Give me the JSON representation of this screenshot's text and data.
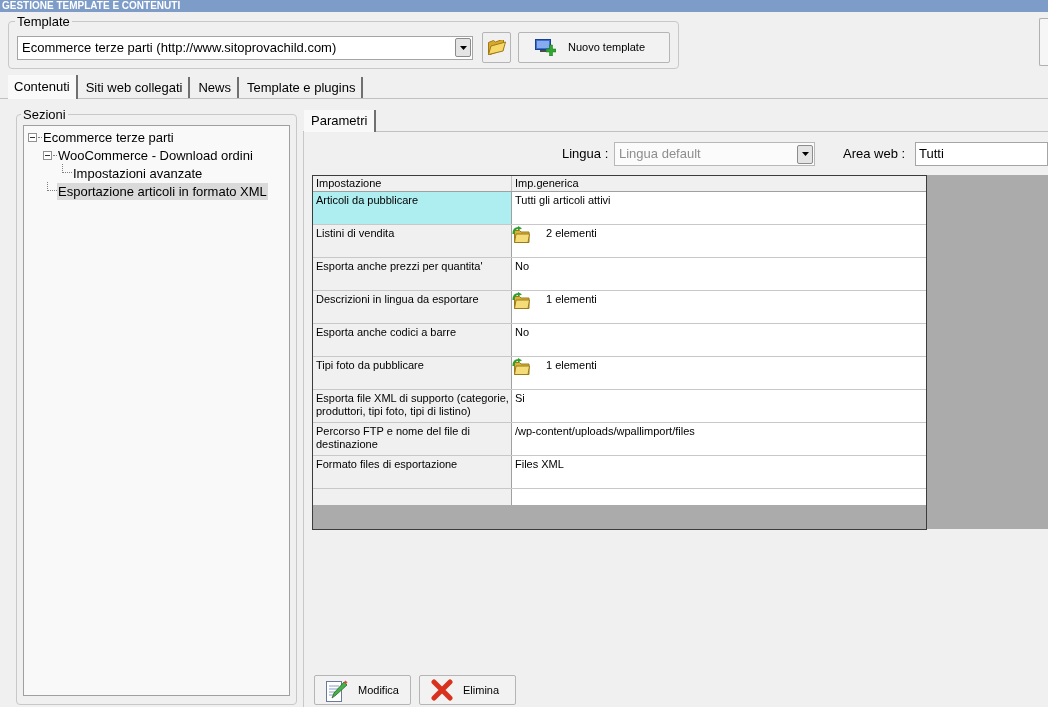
{
  "window": {
    "title": "GESTIONE TEMPLATE E CONTENUTI"
  },
  "template": {
    "label": "Template",
    "value": "Ecommerce terze parti (http://www.sitoprovachild.com)",
    "new_button": "Nuovo template"
  },
  "tabs": [
    {
      "label": "Contenuti",
      "selected": true
    },
    {
      "label": "Siti web collegati",
      "selected": false
    },
    {
      "label": "News",
      "selected": false
    },
    {
      "label": "Template e plugins",
      "selected": false
    }
  ],
  "sections": {
    "label": "Sezioni",
    "tree": [
      {
        "label": "Ecommerce terze parti",
        "expanded": true,
        "selected": false,
        "children": [
          {
            "label": "WooCommerce - Download ordini",
            "expanded": true,
            "selected": false,
            "children": [
              {
                "label": "Impostazioni avanzate",
                "selected": false
              }
            ]
          },
          {
            "label": "Esportazione articoli in formato XML",
            "selected": true
          }
        ]
      }
    ]
  },
  "parameters": {
    "tabs": [
      {
        "label": "Parametri",
        "selected": true
      }
    ],
    "language": {
      "label": "Lingua :",
      "value": "Lingua default",
      "disabled": true
    },
    "area_web": {
      "label": "Area web :",
      "value": "Tutti"
    },
    "table": {
      "columns": [
        "Impostazione",
        "Imp.generica"
      ],
      "rows": [
        {
          "setting": "Articoli da pubblicare",
          "value": "Tutti gli articoli attivi",
          "kind": "text",
          "selected": true
        },
        {
          "setting": "Listini di vendita",
          "value": "2 elementi",
          "kind": "list",
          "selected": false
        },
        {
          "setting": "Esporta anche prezzi per quantita'",
          "value": "No",
          "kind": "text",
          "selected": false
        },
        {
          "setting": "Descrizioni in lingua da esportare",
          "value": "1 elementi",
          "kind": "list",
          "selected": false
        },
        {
          "setting": "Esporta anche codici a barre",
          "value": "No",
          "kind": "text",
          "selected": false
        },
        {
          "setting": "Tipi foto da pubblicare",
          "value": "1 elementi",
          "kind": "list",
          "selected": false
        },
        {
          "setting": "Esporta file XML di supporto (categorie, produttori, tipi foto, tipi di listino)",
          "value": "Si",
          "kind": "text",
          "selected": false
        },
        {
          "setting": "Percorso FTP e nome del file di destinazione",
          "value": "/wp-content/uploads/wpallimport/files",
          "kind": "text",
          "selected": false
        },
        {
          "setting": "Formato files di esportazione",
          "value": "Files XML",
          "kind": "text",
          "selected": false
        }
      ]
    }
  },
  "buttons": [
    {
      "label": "Modifica",
      "kind": "edit"
    },
    {
      "label": "Elimina",
      "kind": "delete"
    }
  ]
}
